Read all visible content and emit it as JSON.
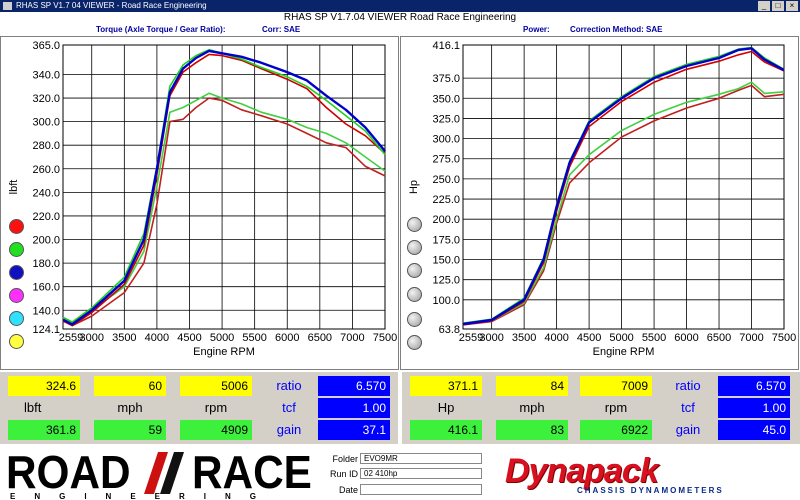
{
  "window": {
    "title": "RHAS SP V1.7 04 VIEWER - Road Race Engineering",
    "min": "_",
    "max": "□",
    "close": "×"
  },
  "header": {
    "title": "RHAS SP V1.7.04  VIEWER   Road Race Engineering"
  },
  "left_panel": {
    "title": "Torque (Axle Torque / Gear Ratio):",
    "corr": "Corr: SAE",
    "ylabel": "lbft",
    "xlabel": "Engine RPM"
  },
  "right_panel": {
    "title": "Power:",
    "corr": "Correction Method: SAE",
    "ylabel": "Hp",
    "xlabel": "Engine RPM"
  },
  "colors": {
    "red": "#d00000",
    "green": "#20d020",
    "blue": "#0000cc",
    "green_light": "#40d040",
    "red_dark": "#c02020"
  },
  "chart_data": [
    {
      "type": "line",
      "name": "torque",
      "xlabel": "Engine RPM",
      "ylabel": "lbft",
      "xlim": [
        2559,
        7500
      ],
      "ylim": [
        124.1,
        365.0
      ],
      "xticks": [
        "2559",
        "3000",
        "3500",
        "4000",
        "4500",
        "5000",
        "5500",
        "6000",
        "6500",
        "7000",
        "7500"
      ],
      "yticks": [
        "365.0",
        "340.0",
        "320.0",
        "300.0",
        "280.0",
        "260.0",
        "240.0",
        "220.0",
        "200.0",
        "180.0",
        "160.0",
        "140.0",
        "124.1"
      ],
      "series": [
        {
          "color": "#0000cc",
          "x": [
            2559,
            2700,
            3000,
            3500,
            3800,
            4000,
            4200,
            4400,
            4600,
            4800,
            5000,
            5300,
            5600,
            6000,
            6300,
            6600,
            6900,
            7200,
            7500
          ],
          "y": [
            132,
            128,
            140,
            165,
            200,
            260,
            325,
            345,
            354,
            360,
            358,
            355,
            350,
            342,
            335,
            322,
            310,
            295,
            275
          ]
        },
        {
          "color": "#20d020",
          "x": [
            2559,
            2700,
            3000,
            3500,
            3800,
            4000,
            4200,
            4400,
            4600,
            4800,
            5000,
            5300,
            5600,
            6000,
            6300,
            6600,
            6900,
            7200,
            7500
          ],
          "y": [
            134,
            130,
            142,
            168,
            205,
            262,
            330,
            348,
            356,
            361,
            358,
            353,
            346,
            338,
            330,
            318,
            305,
            292,
            272
          ]
        },
        {
          "color": "#d00000",
          "x": [
            2559,
            2700,
            3000,
            3500,
            3800,
            4000,
            4200,
            4400,
            4600,
            4800,
            5000,
            5300,
            5600,
            6000,
            6300,
            6600,
            6900,
            7200,
            7500
          ],
          "y": [
            131,
            127,
            138,
            162,
            195,
            255,
            322,
            342,
            350,
            357,
            356,
            352,
            345,
            336,
            328,
            312,
            298,
            288,
            273
          ]
        },
        {
          "color": "#40d040",
          "x": [
            2559,
            2700,
            3000,
            3500,
            3800,
            4000,
            4200,
            4400,
            4600,
            4800,
            5000,
            5300,
            5600,
            6000,
            6300,
            6600,
            6900,
            7200,
            7500
          ],
          "y": [
            133,
            129,
            140,
            160,
            190,
            245,
            308,
            312,
            318,
            324,
            320,
            315,
            308,
            302,
            295,
            290,
            282,
            270,
            258
          ]
        },
        {
          "color": "#c02020",
          "x": [
            2559,
            2700,
            3000,
            3500,
            3800,
            4000,
            4200,
            4400,
            4600,
            4800,
            5000,
            5300,
            5600,
            6000,
            6300,
            6600,
            6900,
            7200,
            7500
          ],
          "y": [
            131,
            127,
            135,
            155,
            180,
            230,
            300,
            302,
            312,
            320,
            318,
            310,
            305,
            298,
            290,
            282,
            278,
            262,
            254
          ]
        }
      ]
    },
    {
      "type": "line",
      "name": "power",
      "xlabel": "Engine RPM",
      "ylabel": "Hp",
      "xlim": [
        2559,
        7500
      ],
      "ylim": [
        63.8,
        416.1
      ],
      "xticks": [
        "2559",
        "3000",
        "3500",
        "4000",
        "4500",
        "5000",
        "5500",
        "6000",
        "6500",
        "7000",
        "7500"
      ],
      "yticks": [
        "416.1",
        "375.0",
        "350.0",
        "325.0",
        "300.0",
        "275.0",
        "250.0",
        "225.0",
        "200.0",
        "175.0",
        "150.0",
        "125.0",
        "100.0",
        "63.8"
      ],
      "series": [
        {
          "color": "#0000cc",
          "x": [
            2559,
            3000,
            3500,
            3800,
            4000,
            4200,
            4500,
            5000,
            5500,
            6000,
            6500,
            6800,
            7000,
            7200,
            7500
          ],
          "y": [
            70,
            75,
            100,
            150,
            215,
            270,
            320,
            350,
            375,
            390,
            400,
            410,
            412,
            398,
            385
          ]
        },
        {
          "color": "#20d020",
          "x": [
            2559,
            3000,
            3500,
            3800,
            4000,
            4200,
            4500,
            5000,
            5500,
            6000,
            6500,
            6800,
            7000,
            7200,
            7500
          ],
          "y": [
            71,
            76,
            102,
            152,
            218,
            272,
            322,
            352,
            377,
            392,
            402,
            411,
            413,
            400,
            386
          ]
        },
        {
          "color": "#d00000",
          "x": [
            2559,
            3000,
            3500,
            3800,
            4000,
            4200,
            4500,
            5000,
            5500,
            6000,
            6500,
            6800,
            7000,
            7200,
            7500
          ],
          "y": [
            69,
            74,
            98,
            146,
            210,
            265,
            315,
            346,
            370,
            386,
            396,
            404,
            408,
            395,
            384
          ]
        },
        {
          "color": "#40d040",
          "x": [
            2559,
            3000,
            3500,
            3800,
            4000,
            4200,
            4500,
            5000,
            5500,
            6000,
            6500,
            6800,
            7000,
            7200,
            7500
          ],
          "y": [
            70,
            74,
            96,
            140,
            200,
            255,
            280,
            310,
            330,
            345,
            355,
            362,
            370,
            356,
            358
          ]
        },
        {
          "color": "#c02020",
          "x": [
            2559,
            3000,
            3500,
            3800,
            4000,
            4200,
            4500,
            5000,
            5500,
            6000,
            6500,
            6800,
            7000,
            7200,
            7500
          ],
          "y": [
            69,
            73,
            94,
            136,
            195,
            245,
            270,
            302,
            322,
            338,
            350,
            360,
            366,
            352,
            355
          ]
        }
      ]
    }
  ],
  "left_readout": {
    "top": [
      "324.6",
      "60",
      "5006"
    ],
    "labels": [
      "lbft",
      "mph",
      "rpm"
    ],
    "bottom": [
      "361.8",
      "59",
      "4909"
    ],
    "side_labels": [
      "ratio",
      "tcf",
      "gain"
    ],
    "side_values": [
      "6.570",
      "1.00",
      "37.1"
    ]
  },
  "right_readout": {
    "top": [
      "371.1",
      "84",
      "7009"
    ],
    "labels": [
      "Hp",
      "mph",
      "rpm"
    ],
    "bottom": [
      "416.1",
      "83",
      "6922"
    ],
    "side_labels": [
      "ratio",
      "tcf",
      "gain"
    ],
    "side_values": [
      "6.570",
      "1.00",
      "45.0"
    ]
  },
  "footer": {
    "road": "ROAD",
    "race": "RACE",
    "engineering": "ENGINEERING",
    "folder_label": "Folder",
    "folder_value": "EVO9MR",
    "run_label": "Run ID",
    "run_value": "02 410hp",
    "date_label": "Date",
    "date_value": "",
    "dynapack": "Dynapack",
    "dyna_sub": "CHASSIS DYNAMOMETERS"
  }
}
